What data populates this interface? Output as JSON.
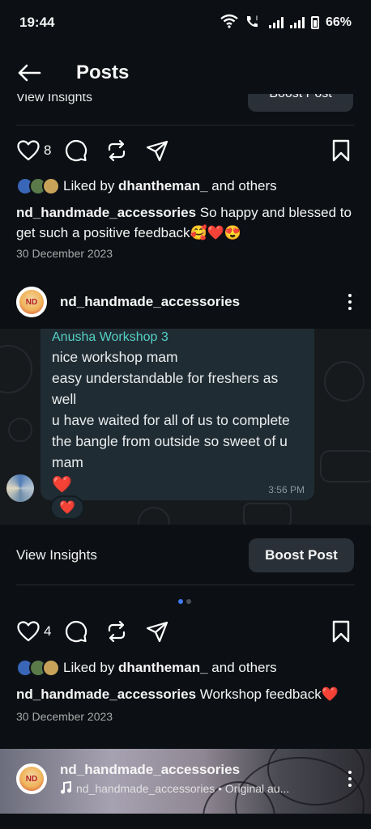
{
  "status_bar": {
    "time": "19:44",
    "battery": "66%"
  },
  "header": {
    "title": "Posts"
  },
  "cut_strip": {
    "view_insights": "View Insights",
    "boost_post": "Boost Post"
  },
  "post1": {
    "likes": "8",
    "liked_by_prefix": "Liked by ",
    "liked_by_user": "dhantheman_",
    "liked_by_suffix": " and others",
    "caption_user": "nd_handmade_accessories",
    "caption_text": " So happy and blessed to get such a positive feedback🥰❤️😍",
    "date": "30 December 2023"
  },
  "post2": {
    "username": "nd_handmade_accessories",
    "logo_text": "ND",
    "chat": {
      "sender": "Anusha Workshop 3",
      "lines": [
        "nice workshop mam",
        "easy understandable for freshers as well",
        "u have waited for all of us to complete the bangle from outside so sweet of u mam"
      ],
      "heart": "❤️",
      "time": "3:56 PM",
      "reaction": "❤️"
    },
    "view_insights": "View Insights",
    "boost_post": "Boost Post",
    "likes": "4",
    "liked_by_prefix": "Liked by ",
    "liked_by_user": "dhantheman_",
    "liked_by_suffix": " and others",
    "caption_user": "nd_handmade_accessories",
    "caption_text": " Workshop feedback❤️",
    "date": "30 December 2023"
  },
  "post3": {
    "username": "nd_handmade_accessories",
    "audio": "nd_handmade_accessories • Original au..."
  },
  "colors": {
    "background": "#0c1014",
    "button": "#2a3038",
    "chat_bubble": "#202c33",
    "chat_name": "#53d1c6",
    "dot_active": "#3f7bf6",
    "dot_inactive": "#4a5058"
  },
  "icons": [
    "back-arrow-icon",
    "heart-icon",
    "comment-icon",
    "repost-icon",
    "share-icon",
    "bookmark-icon",
    "more-icon",
    "music-note-icon"
  ]
}
